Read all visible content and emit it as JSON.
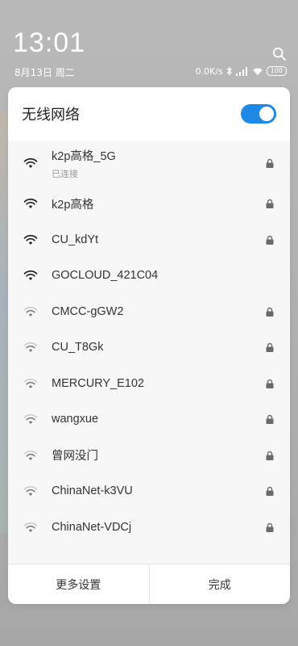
{
  "status": {
    "time": "13:01",
    "date": "8月13日 周二",
    "speed": "0.0K/s",
    "battery": "100"
  },
  "panel": {
    "title": "无线网络",
    "toggle_on": true,
    "accent": "#1e88e5"
  },
  "networks": [
    {
      "ssid": "k2p高格_5G",
      "sub": "已连接",
      "locked": true,
      "strength": "strong"
    },
    {
      "ssid": "k2p高格",
      "locked": true,
      "strength": "strong"
    },
    {
      "ssid": "CU_kdYt",
      "locked": true,
      "strength": "strong"
    },
    {
      "ssid": "GOCLOUD_421C04",
      "locked": false,
      "strength": "strong"
    },
    {
      "ssid": "CMCC-gGW2",
      "locked": true,
      "strength": "weak"
    },
    {
      "ssid": "CU_T8Gk",
      "locked": true,
      "strength": "weak"
    },
    {
      "ssid": "MERCURY_E102",
      "locked": true,
      "strength": "weak"
    },
    {
      "ssid": "wangxue",
      "locked": true,
      "strength": "weak"
    },
    {
      "ssid": "曾网没门",
      "locked": true,
      "strength": "weak"
    },
    {
      "ssid": "ChinaNet-k3VU",
      "locked": true,
      "strength": "weak"
    },
    {
      "ssid": "ChinaNet-VDCj",
      "locked": true,
      "strength": "weak"
    }
  ],
  "footer": {
    "more_settings": "更多设置",
    "done": "完成"
  },
  "icons": {
    "wifi": "wifi-icon",
    "lock": "lock-icon",
    "search": "search-icon",
    "bluetooth": "bluetooth-icon",
    "signal": "signal-icon"
  }
}
